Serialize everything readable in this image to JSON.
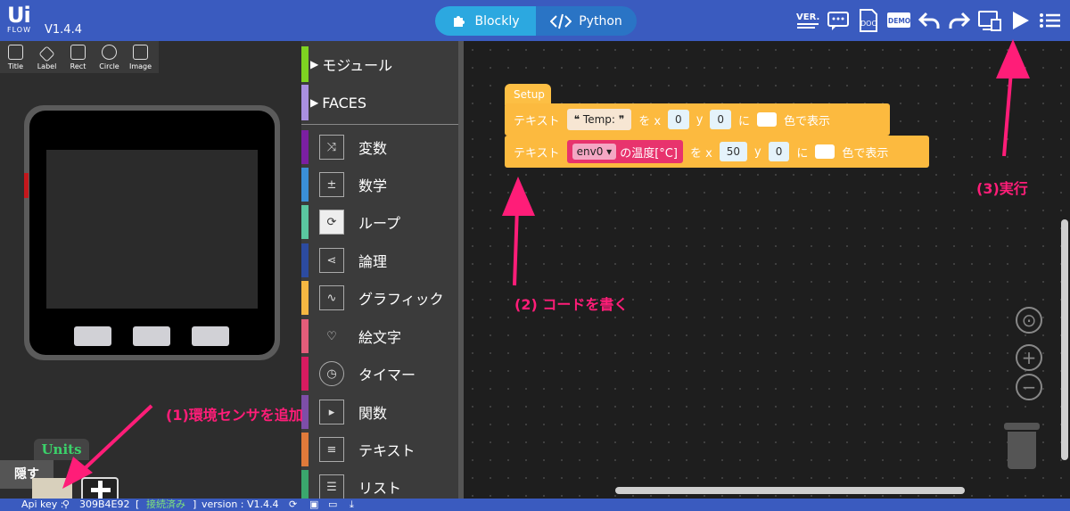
{
  "app": {
    "logo_text": "Ui",
    "logo_sub": "FLOW",
    "version": "V1.4.4"
  },
  "modes": {
    "blockly": "Blockly",
    "python": "Python"
  },
  "toolbar_icons": [
    "version-icon",
    "message-icon",
    "doc-icon",
    "demo-icon",
    "undo-icon",
    "redo-icon",
    "device-icon",
    "run-icon",
    "menu-icon"
  ],
  "toolbar_labels": {
    "ver": "VER.",
    "doc": "DOC",
    "demo": "DEMO"
  },
  "ui_tools": [
    {
      "label": "Title"
    },
    {
      "label": "Label"
    },
    {
      "label": "Rect"
    },
    {
      "label": "Circle"
    },
    {
      "label": "Image"
    }
  ],
  "units": {
    "tab": "Units",
    "hide": "隠す"
  },
  "categories": [
    {
      "label": "モジュール",
      "color": "#7ed321",
      "expand": true
    },
    {
      "label": "FACES",
      "color": "#a98fe0",
      "expand": true
    },
    {
      "label": "変数",
      "color": "#7b1fa2",
      "icon": "shuffle-icon"
    },
    {
      "label": "数学",
      "color": "#3a8fd8",
      "icon": "math-icon"
    },
    {
      "label": "ループ",
      "color": "#5ac7a0",
      "icon": "loop-icon"
    },
    {
      "label": "論理",
      "color": "#2c4ba0",
      "icon": "logic-icon"
    },
    {
      "label": "グラフィック",
      "color": "#f5b742",
      "icon": "graph-icon"
    },
    {
      "label": "絵文字",
      "color": "#e35d7a",
      "icon": "emoji-icon"
    },
    {
      "label": "タイマー",
      "color": "#d81b60",
      "icon": "timer-icon"
    },
    {
      "label": "関数",
      "color": "#7d4ea8",
      "icon": "function-icon"
    },
    {
      "label": "テキスト",
      "color": "#e07a3a",
      "icon": "text-icon"
    },
    {
      "label": "リスト",
      "color": "#3aa76d",
      "icon": "list-icon"
    }
  ],
  "blocks": {
    "setup": "Setup",
    "row1": {
      "label": "テキスト",
      "value": "Temp:",
      "wo_x": "を x",
      "x": "0",
      "y_label": "y",
      "y": "0",
      "ni": "に",
      "suffix": "色で表示"
    },
    "row2": {
      "label": "テキスト",
      "sensor": "env0",
      "sensor_prop": "の温度[°C]",
      "wo_x": "を x",
      "x": "50",
      "y_label": "y",
      "y": "0",
      "ni": "に",
      "suffix": "色で表示"
    }
  },
  "annotations": {
    "step1": "(1)環境センサを追加",
    "step2": "(2)  コードを書く",
    "step3": "(3)実行"
  },
  "status": {
    "api_label": "Api key :",
    "api_key": "309B4E92",
    "connection": "接続済み",
    "version": "version : V1.4.4"
  },
  "colors": {
    "topbar": "#3a5bbf",
    "block": "#fcba3f",
    "accent": "#ff1d78",
    "sensor": "#e8336d"
  }
}
